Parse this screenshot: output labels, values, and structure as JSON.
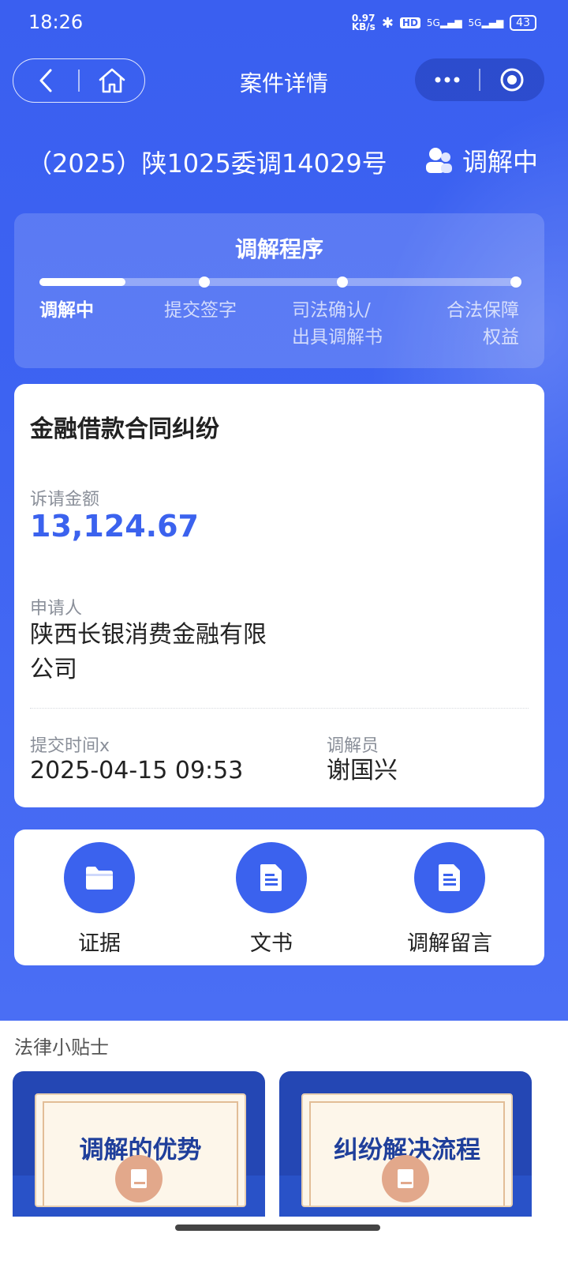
{
  "status_bar": {
    "time": "18:26",
    "net_speed_top": "0.97",
    "net_speed_bottom": "KB/s",
    "hd": "HD",
    "signal1": "5G",
    "signal2": "5G",
    "battery": "43"
  },
  "nav": {
    "title": "案件详情"
  },
  "case": {
    "number": "（2025）陕1025委调14029号",
    "status": "调解中"
  },
  "process": {
    "title": "调解程序",
    "progress": 0.18,
    "steps": [
      {
        "line1": "调解中",
        "line2": ""
      },
      {
        "line1": "提交签字",
        "line2": ""
      },
      {
        "line1": "司法确认/",
        "line2": "出具调解书"
      },
      {
        "line1": "合法保障",
        "line2": "权益"
      }
    ]
  },
  "details": {
    "case_type": "金融借款合同纠纷",
    "amount_label": "诉请金额",
    "amount": "13,124.67",
    "applicant_label": "申请人",
    "applicant_line1": "陕西长银消费金融有限",
    "applicant_line2": "公司",
    "submit_time_label": "提交时间x",
    "submit_time": "2025-04-15 09:53",
    "mediator_label": "调解员",
    "mediator": "谢国兴"
  },
  "actions": [
    {
      "label": "证据",
      "icon": "folder-icon"
    },
    {
      "label": "文书",
      "icon": "document-icon"
    },
    {
      "label": "调解留言",
      "icon": "document-icon"
    }
  ],
  "tips": {
    "title": "法律小贴士",
    "cards": [
      {
        "text": "调解的优势"
      },
      {
        "text": "纠纷解决流程"
      }
    ]
  },
  "colors": {
    "primary": "#3b62ee",
    "hero_bg": "#3d63f2",
    "text_dark": "#222222",
    "text_muted": "#8a8f99"
  }
}
